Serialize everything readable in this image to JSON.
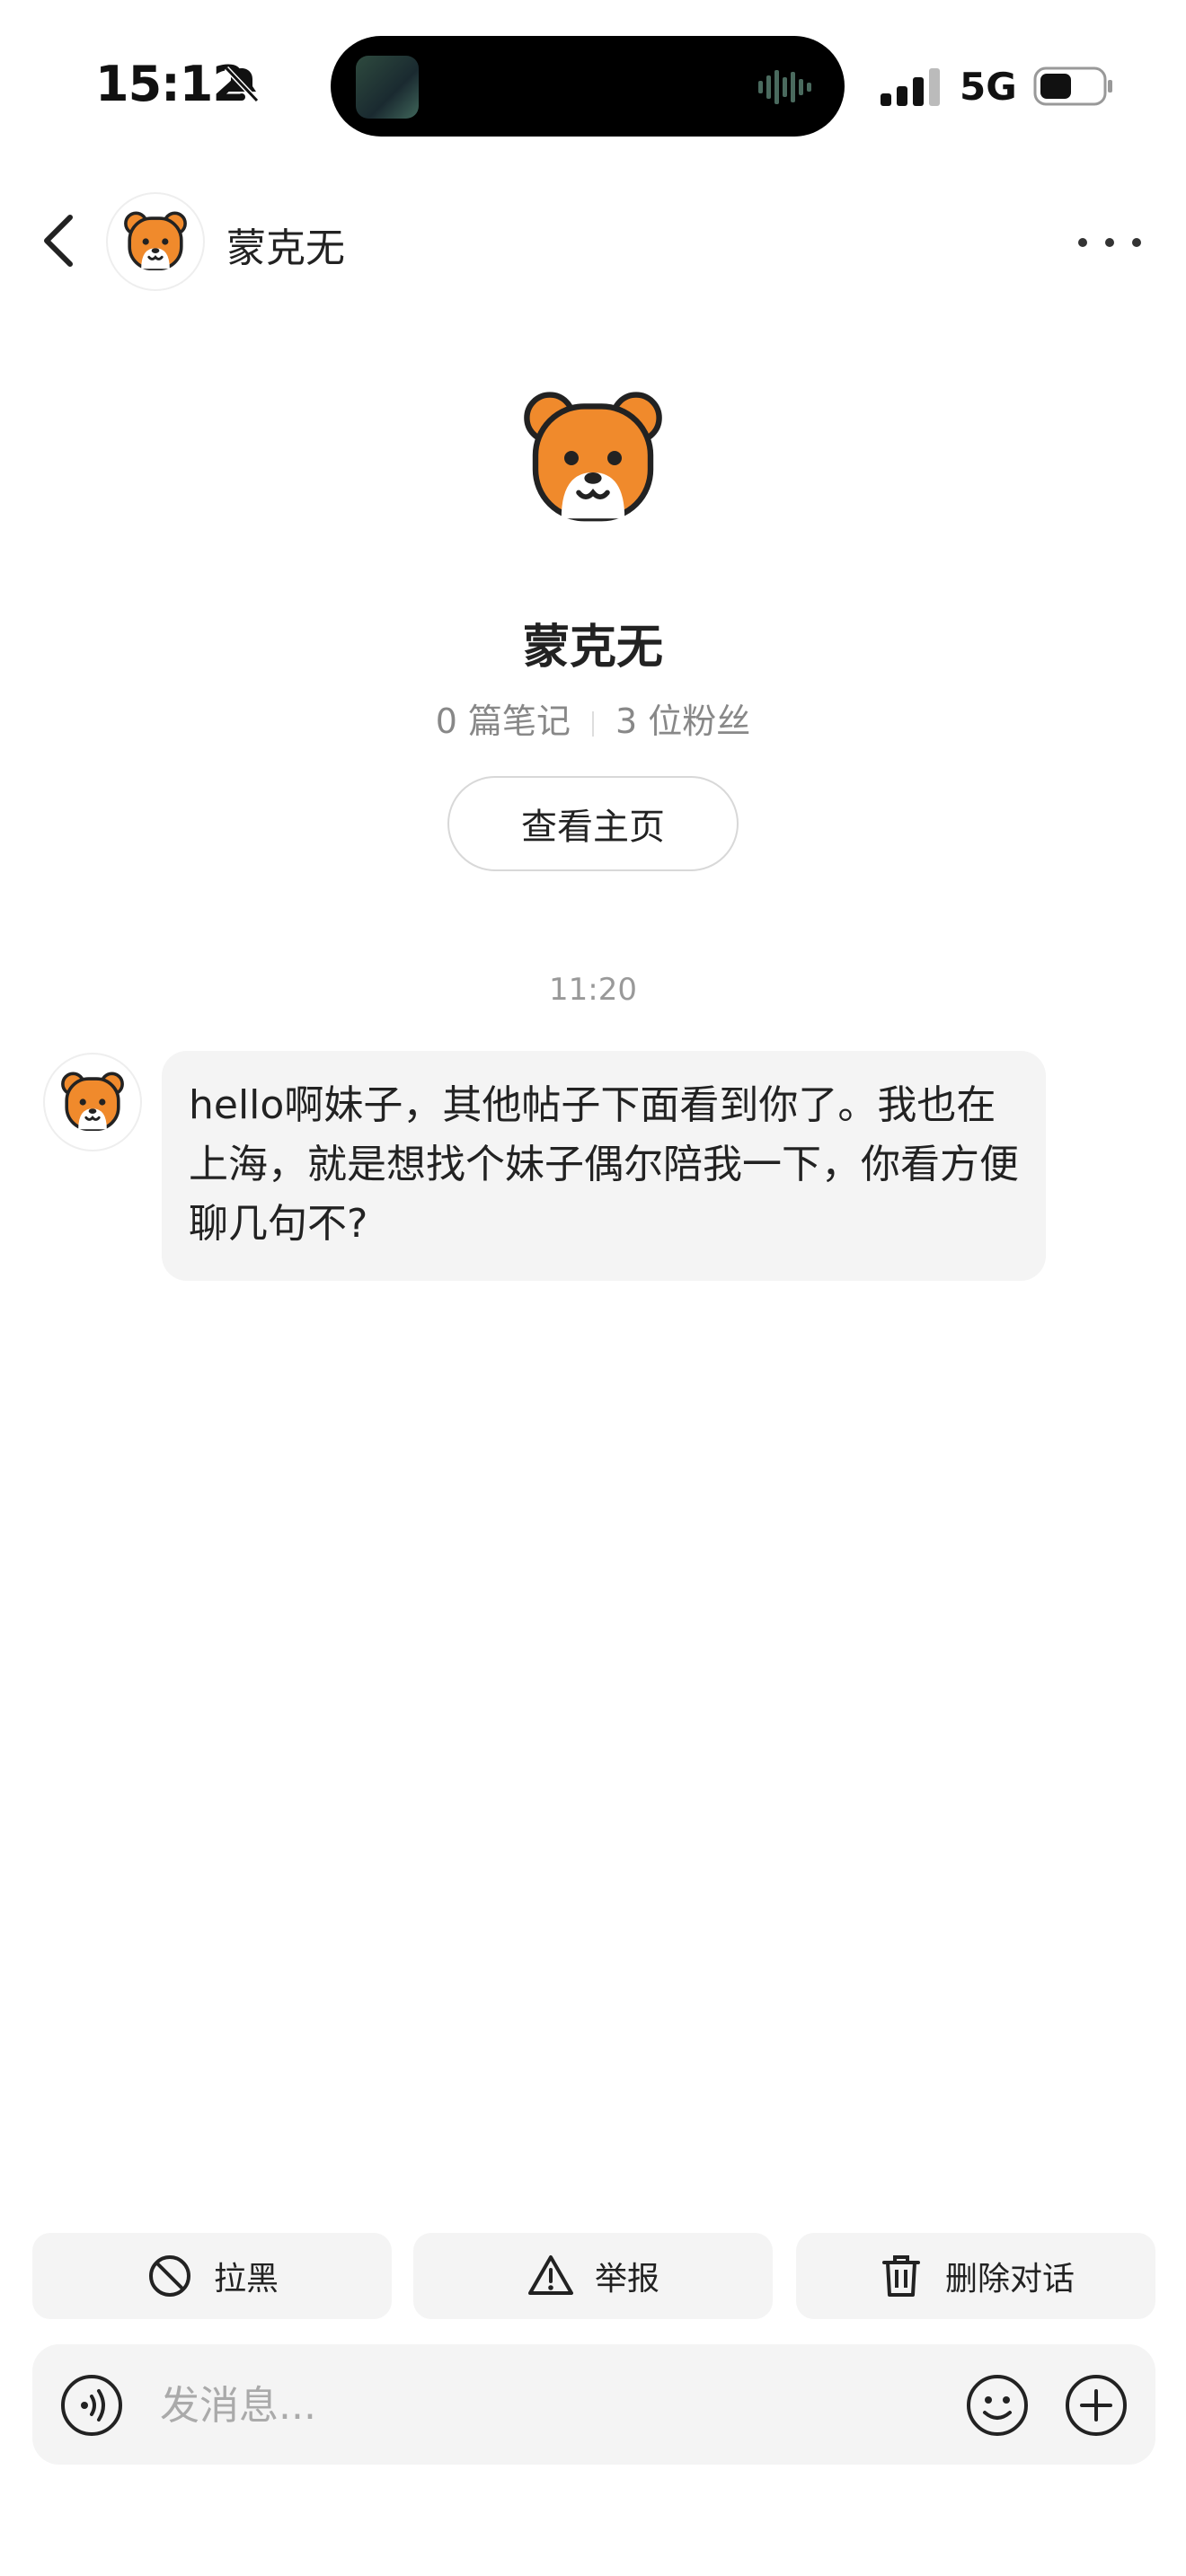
{
  "status_bar": {
    "time": "15:12",
    "network": "5G",
    "icons": [
      "bell-muted-icon",
      "signal-icon",
      "battery-icon",
      "audio-wave-icon"
    ]
  },
  "header": {
    "contact_name": "蒙克无",
    "icons": [
      "back-arrow-icon",
      "bear-avatar-icon",
      "more-icon"
    ]
  },
  "profile": {
    "name": "蒙克无",
    "notes": "0 篇笔记",
    "fans": "3 位粉丝",
    "view_home_label": "查看主页"
  },
  "conversation": {
    "timestamp": "11:20",
    "messages": [
      {
        "sender": "蒙克无",
        "text": "hello啊妹子，其他帖子下面看到你了。我也在上海，就是想找个妹子偶尔陪我一下，你看方便聊几句不?"
      }
    ]
  },
  "actions": {
    "block_label": "拉黑",
    "report_label": "举报",
    "delete_label": "删除对话"
  },
  "input": {
    "placeholder": "发消息..."
  },
  "colors": {
    "bear_orange": "#F08A2C",
    "bubble_bg": "#F4F4F4",
    "muted_text": "#888888"
  }
}
